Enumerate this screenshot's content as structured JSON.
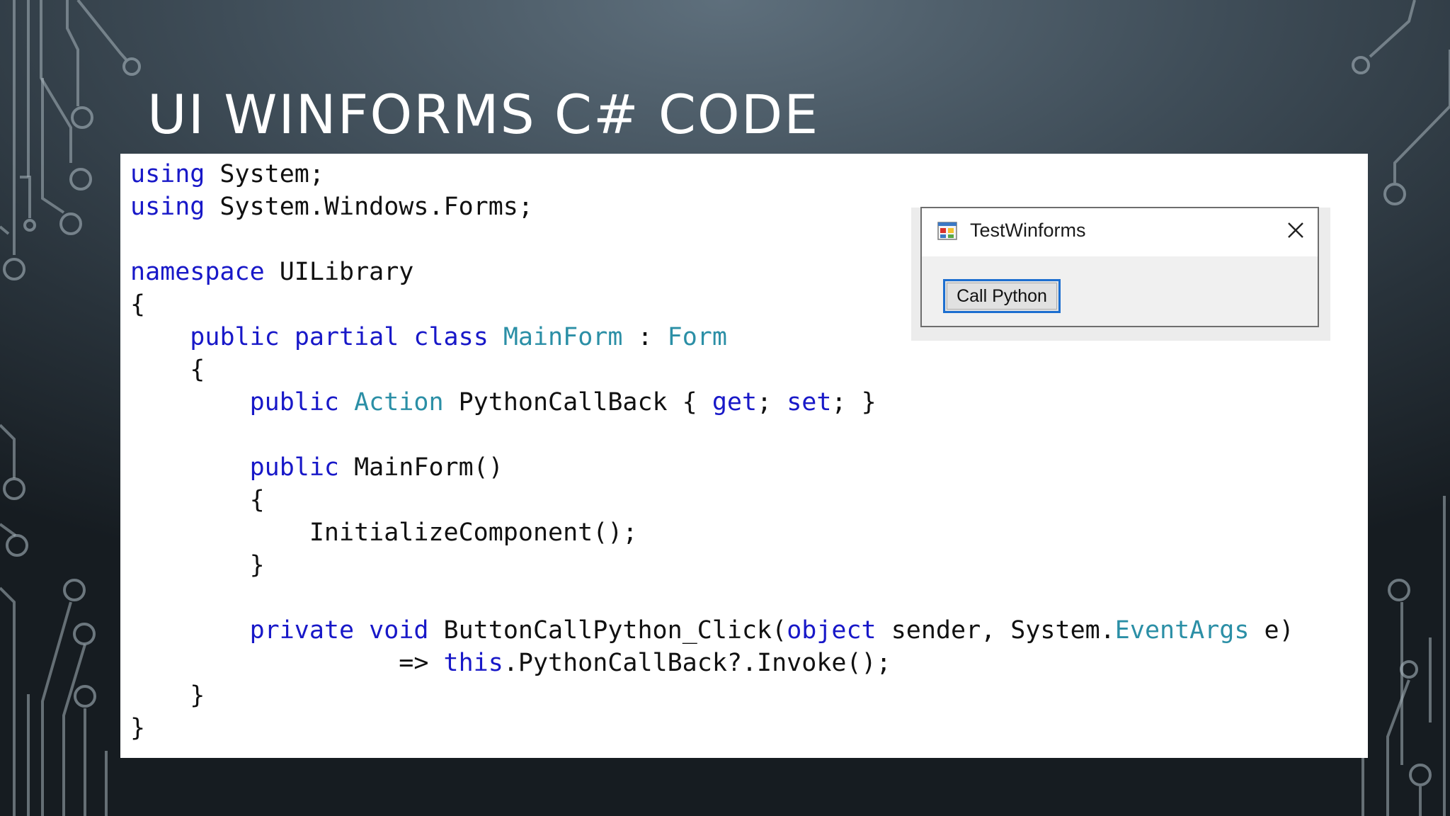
{
  "slide": {
    "title": "UI WINFORMS C# CODE"
  },
  "code": {
    "lines": [
      [
        {
          "t": "using",
          "c": "kw"
        },
        {
          "t": " System;"
        }
      ],
      [
        {
          "t": "using",
          "c": "kw"
        },
        {
          "t": " System.Windows.Forms;"
        }
      ],
      [],
      [
        {
          "t": "namespace",
          "c": "kw"
        },
        {
          "t": " UILibrary"
        }
      ],
      [
        {
          "t": "{"
        }
      ],
      [
        {
          "t": "    "
        },
        {
          "t": "public",
          "c": "kw"
        },
        {
          "t": " "
        },
        {
          "t": "partial",
          "c": "kw"
        },
        {
          "t": " "
        },
        {
          "t": "class",
          "c": "kw"
        },
        {
          "t": " "
        },
        {
          "t": "MainForm",
          "c": "ty"
        },
        {
          "t": " : "
        },
        {
          "t": "Form",
          "c": "ty"
        }
      ],
      [
        {
          "t": "    {"
        }
      ],
      [
        {
          "t": "        "
        },
        {
          "t": "public",
          "c": "kw"
        },
        {
          "t": " "
        },
        {
          "t": "Action",
          "c": "ty"
        },
        {
          "t": " PythonCallBack { "
        },
        {
          "t": "get",
          "c": "kw"
        },
        {
          "t": "; "
        },
        {
          "t": "set",
          "c": "kw"
        },
        {
          "t": "; }"
        }
      ],
      [],
      [
        {
          "t": "        "
        },
        {
          "t": "public",
          "c": "kw"
        },
        {
          "t": " MainForm()"
        }
      ],
      [
        {
          "t": "        {"
        }
      ],
      [
        {
          "t": "            InitializeComponent();"
        }
      ],
      [
        {
          "t": "        }"
        }
      ],
      [],
      [
        {
          "t": "        "
        },
        {
          "t": "private",
          "c": "kw"
        },
        {
          "t": " "
        },
        {
          "t": "void",
          "c": "kw"
        },
        {
          "t": " ButtonCallPython_Click("
        },
        {
          "t": "object",
          "c": "kw"
        },
        {
          "t": " sender, System."
        },
        {
          "t": "EventArgs",
          "c": "ty"
        },
        {
          "t": " e)"
        }
      ],
      [
        {
          "t": "                  => "
        },
        {
          "t": "this",
          "c": "kw"
        },
        {
          "t": ".PythonCallBack?.Invoke();"
        }
      ],
      [
        {
          "t": "    }"
        }
      ],
      [
        {
          "t": "}"
        }
      ]
    ]
  },
  "window": {
    "title": "TestWinforms",
    "button_label": "Call Python",
    "icon": "winforms-app-icon",
    "close_icon": "close-icon"
  },
  "colors": {
    "keyword": "#1818c8",
    "type": "#2b8fa6",
    "button_border": "#1d6fd0"
  }
}
